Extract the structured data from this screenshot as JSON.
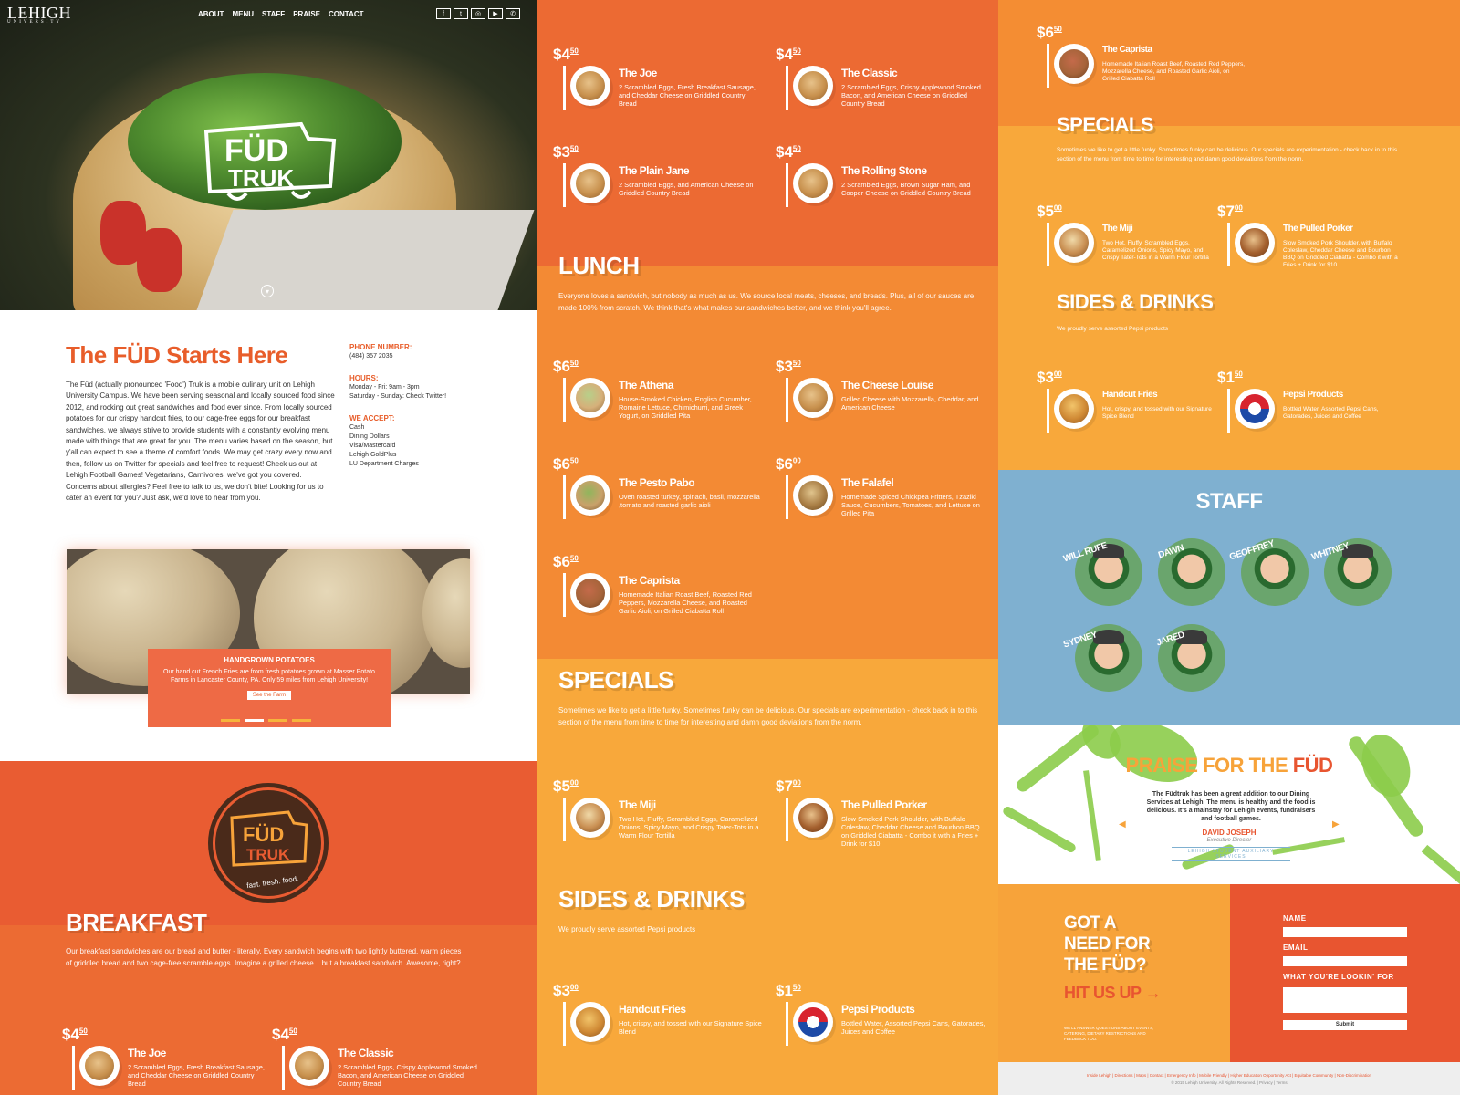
{
  "nav": {
    "brand": "LEHIGH",
    "brand_sub": "UNIVERSITY",
    "links": [
      "ABOUT",
      "MENU",
      "STAFF",
      "PRAISE",
      "CONTACT"
    ],
    "social_icons": [
      "facebook-icon",
      "twitter-icon",
      "instagram-icon",
      "youtube-icon",
      "phone-icon"
    ]
  },
  "hero": {
    "logo_line1": "FÜD",
    "logo_line2": "TRUK"
  },
  "intro": {
    "title": "The FÜD Starts Here",
    "body": "The Füd (actually pronounced 'Food') Truk is a mobile culinary unit on Lehigh University Campus. We have been serving seasonal and locally sourced food since 2012, and rocking out great sandwiches and food ever since. From locally sourced potatoes for our crispy handcut fries, to our cage-free eggs for our breakfast sandwiches, we always strive to provide students with a constantly evolving menu made with things that are great for you. The menu varies based on the season, but y'all can expect to see a theme of comfort foods. We may get crazy every now and then, follow us on Twitter for specials and feel free to request! Check us out at Lehigh Football Games! Vegetarians, Carnivores, we've got you covered. Concerns about allergies? Feel free to talk to us, we don't bite! Looking for us to cater an event for you? Just ask, we'd love to hear from you.",
    "phone_label": "PHONE NUMBER:",
    "phone": "(484) 357 2035",
    "hours_label": "HOURS:",
    "hours": [
      "Monday - Fri: 9am - 3pm",
      "Saturday - Sunday: Check Twitter!"
    ],
    "accept_label": "WE ACCEPT:",
    "accept": [
      "Cash",
      "Dining Dollars",
      "Visa/Mastercard",
      "Lehigh GoldPlus",
      "LU Department Charges"
    ]
  },
  "potatoes": {
    "title": "HANDGROWN POTATOES",
    "body": "Our hand cut French Fries are from fresh potatoes grown at Masser Potato Farms in Lancaster County, PA. Only 59 miles from Lehigh University!",
    "button": "See the Farm"
  },
  "badge": {
    "line1": "FÜD",
    "line2": "TRUK",
    "tagline": "fast. fresh. food."
  },
  "breakfast": {
    "title": "BREAKFAST",
    "desc": "Our breakfast sandwiches are our bread and butter - literally. Every sandwich begins with two lightly buttered, warm pieces of griddled bread and two cage-free scramble eggs. Imagine a grilled cheese... but a breakfast sandwich. Awesome, right?",
    "items": [
      {
        "dollars": "$4",
        "cents": "50",
        "name": "The Joe",
        "desc": "2 Scrambled Eggs, Fresh Breakfast Sausage, and Cheddar Cheese on Griddled Country Bread"
      },
      {
        "dollars": "$4",
        "cents": "50",
        "name": "The Classic",
        "desc": "2 Scrambled Eggs, Crispy Applewood Smoked Bacon, and American Cheese on Griddled Country Bread"
      },
      {
        "dollars": "$3",
        "cents": "50",
        "name": "The Plain Jane",
        "desc": "2 Scrambled Eggs, and American Cheese on Griddled Country Bread"
      },
      {
        "dollars": "$4",
        "cents": "50",
        "name": "The Rolling Stone",
        "desc": "2 Scrambled Eggs, Brown Sugar Ham, and Cooper Cheese on Griddled Country Bread"
      }
    ]
  },
  "lunch": {
    "title": "LUNCH",
    "desc": "Everyone loves a sandwich, but nobody as much as us. We source local meats, cheeses, and breads. Plus, all of our sauces are made 100% from scratch. We think that's what makes our sandwiches better, and we think you'll agree.",
    "items": [
      {
        "dollars": "$6",
        "cents": "50",
        "name": "The Athena",
        "desc": "House-Smoked Chicken, English Cucumber, Romaine Lettuce, Chimichurri, and Greek Yogurt, on Griddled Pita"
      },
      {
        "dollars": "$3",
        "cents": "50",
        "name": "The Cheese Louise",
        "desc": "Grilled Cheese with Mozzarella, Cheddar, and American Cheese"
      },
      {
        "dollars": "$6",
        "cents": "50",
        "name": "The Pesto Pabo",
        "desc": "Oven roasted turkey, spinach, basil, mozzarella ,tomato and roasted garlic aioli"
      },
      {
        "dollars": "$6",
        "cents": "00",
        "name": "The Falafel",
        "desc": "Homemade Spiced Chickpea Fritters, Tzaziki Sauce, Cucumbers, Tomatoes, and Lettuce on Grilled Pita"
      },
      {
        "dollars": "$6",
        "cents": "50",
        "name": "The Caprista",
        "desc": "Homemade Italian Roast Beef, Roasted Red Peppers, Mozzarella Cheese, and Roasted Garlic Aioli, on Grilled Ciabatta Roll"
      }
    ]
  },
  "specials": {
    "title": "SPECIALS",
    "desc": "Sometimes we like to get a little funky. Sometimes funky can be delicious. Our specials are experimentation - check back in to this section of the menu from time to time for interesting and damn good deviations from the norm.",
    "items": [
      {
        "dollars": "$5",
        "cents": "00",
        "name": "The Miji",
        "desc": "Two Hot, Fluffy, Scrambled Eggs, Caramelized Onions, Spicy Mayo, and Crispy Tater-Tots in a Warm Flour Tortilla"
      },
      {
        "dollars": "$7",
        "cents": "00",
        "name": "The Pulled Porker",
        "desc": "Slow Smoked Pork Shoulder, with Buffalo Coleslaw, Cheddar Cheese and Bourbon BBQ on Griddled Ciabatta - Combo it with a Fries + Drink for $10"
      }
    ]
  },
  "sides": {
    "title": "SIDES & DRINKS",
    "desc": "We proudly serve assorted Pepsi products",
    "items": [
      {
        "dollars": "$3",
        "cents": "00",
        "name": "Handcut Fries",
        "desc": "Hot, crispy, and tossed with our Signature Spice Blend"
      },
      {
        "dollars": "$1",
        "cents": "50",
        "name": "Pepsi Products",
        "desc": "Bottled Water, Assorted Pepsi Cans, Gatorades, Juices and Coffee"
      }
    ]
  },
  "staff": {
    "title": "STAFF",
    "people": [
      "WILL RUFE",
      "DAWN",
      "GEOFFREY",
      "WHITNEY",
      "SYDNEY",
      "JARED"
    ]
  },
  "praise": {
    "title_a": "PRAISE FOR THE ",
    "title_b": "FÜD",
    "quote": "The Füdtruk has been a great addition to our Dining Services at Lehigh. The menu is healthy and the food is delicious. It's a mainstay for Lehigh events, fundraisers and football games.",
    "author": "DAVID JOSEPH",
    "role": "Executive Director",
    "org": "LEHIGH STUDENT AUXILIARY SERVICES"
  },
  "contact": {
    "heading": "GOT A NEED FOR THE FÜD?",
    "cta": "HIT US UP",
    "note": "WE'LL ANSWER QUESTIONS ABOUT EVENTS, CATERING, DIETARY RESTRICTIONS AND FEEDBACK TOO.",
    "name_label": "NAME",
    "email_label": "EMAIL",
    "need_label": "WHAT YOU'RE LOOKIN' FOR",
    "submit": "Submit"
  },
  "footer": {
    "links": "Inside Lehigh | Directions | Maps | Contact | Emergency Info | Mobile Friendly | Higher Education Opportunity Act | Equitable Community | Non-Discrimination",
    "copyright": "© 2015 Lehigh University. All Rights Reserved. | Privacy | Terms"
  },
  "colors": {
    "orange": "#e95c32",
    "light_orange": "#f7a33a",
    "blue": "#7fb0d0",
    "green": "#8ccc4a"
  }
}
